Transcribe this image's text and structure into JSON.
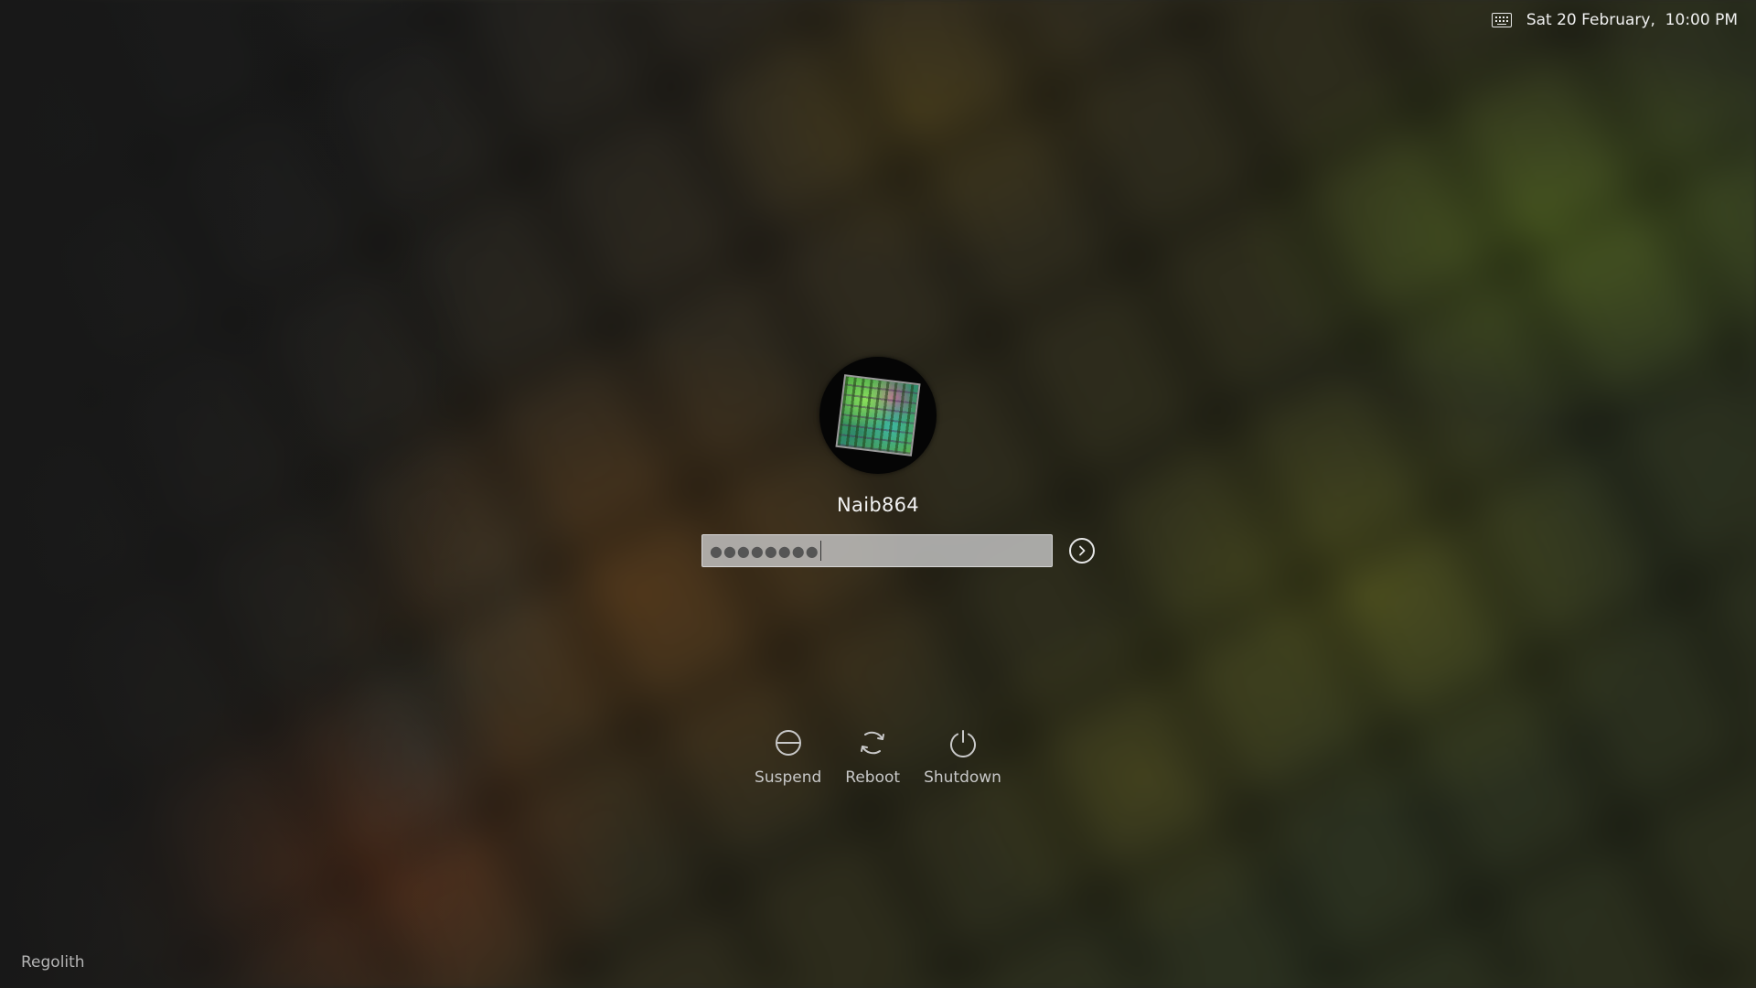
{
  "topbar": {
    "keyboard_icon": "keyboard-icon",
    "datetime": "Sat 20 February,  10:00 PM"
  },
  "login": {
    "avatar_icon": "user-avatar",
    "username": "Naib864",
    "password_masked": "●●●●●●●●",
    "submit_icon": "arrow-right-circle-icon"
  },
  "actions": [
    {
      "label": "Suspend",
      "icon": "suspend-icon"
    },
    {
      "label": "Reboot",
      "icon": "reboot-icon"
    },
    {
      "label": "Shutdown",
      "icon": "shutdown-icon"
    }
  ],
  "session": {
    "label": "Regolith"
  },
  "colors": {
    "text": "#f0f0f0",
    "field_bg": "#c6c6c6",
    "icon": "#c8c8c8"
  }
}
